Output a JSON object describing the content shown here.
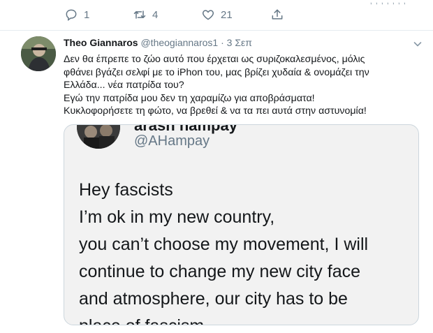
{
  "previous_tweet": {
    "actions": {
      "reply_count": "1",
      "retweet_count": "4",
      "like_count": "21"
    }
  },
  "tweet": {
    "author_name": "Theo Giannaros",
    "author_handle": "@theogiannaros1",
    "separator": "·",
    "time": "3 Σεπ",
    "text_lines": [
      "Δεν θα έπρεπε το ζώο αυτό που έρχεται ως συριζοκαλεσμένος, μόλις",
      "φθάνει βγάζει σελφί με το iPhon του, μας βρίζει χυδαία & ονομάζει την",
      "Ελλάδα... νέα πατρίδα του?",
      "Εγώ την πατρίδα μου δεν τη χαραμίζω για αποβράσματα!",
      "Κυκλοφορήσετε τη φώτο, να βρεθεί & να τα πει αυτά στην αστυνομία!"
    ]
  },
  "embedded_image": {
    "name": "arash hampay",
    "handle": "@AHampay",
    "lines": [
      "Hey fascists",
      "I’m ok in my new country,",
      "you can’t choose my movement, I will",
      "continue to change my new city face",
      "and atmosphere, our city has to be",
      "place of fascism"
    ]
  },
  "icons": {
    "reply": "reply-icon",
    "retweet": "retweet-icon",
    "like": "heart-icon",
    "share": "share-icon",
    "menu": "chevron-down-icon"
  },
  "colors": {
    "text_primary": "#14171a",
    "text_secondary": "#657786",
    "border": "#e6ecf0",
    "image_bg": "#f2f2f2"
  }
}
